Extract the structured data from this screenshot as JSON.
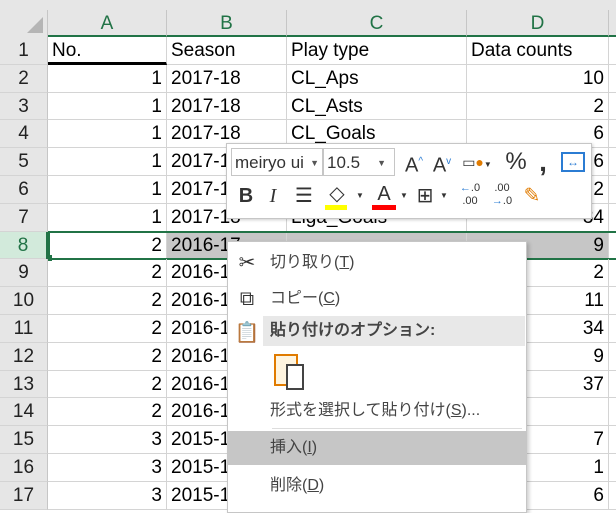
{
  "columns": [
    "A",
    "B",
    "C",
    "D"
  ],
  "rows": [
    {
      "n": "1",
      "a": "No.",
      "b": "Season",
      "c": "Play type",
      "d": "Data counts",
      "header": true
    },
    {
      "n": "2",
      "a": "1",
      "b": "2017-18",
      "c": "CL_Aps",
      "d": "10"
    },
    {
      "n": "3",
      "a": "1",
      "b": "2017-18",
      "c": "CL_Asts",
      "d": "2"
    },
    {
      "n": "4",
      "a": "1",
      "b": "2017-18",
      "c": "CL_Goals",
      "d": "6"
    },
    {
      "n": "5",
      "a": "1",
      "b": "2017-18",
      "c": "",
      "d": "6"
    },
    {
      "n": "6",
      "a": "1",
      "b": "2017-18",
      "c": "",
      "d": "2"
    },
    {
      "n": "7",
      "a": "1",
      "b": "2017-18",
      "c": "Liga_Goals",
      "d": "34"
    },
    {
      "n": "8",
      "a": "2",
      "b": "2016-17",
      "c": "",
      "d": "9",
      "selected": true
    },
    {
      "n": "9",
      "a": "2",
      "b": "2016-17",
      "c": "",
      "d": "2"
    },
    {
      "n": "10",
      "a": "2",
      "b": "2016-17",
      "c": "",
      "d": "11"
    },
    {
      "n": "11",
      "a": "2",
      "b": "2016-17",
      "c": "",
      "d": "34"
    },
    {
      "n": "12",
      "a": "2",
      "b": "2016-17",
      "c": "",
      "d": "9"
    },
    {
      "n": "13",
      "a": "2",
      "b": "2016-17",
      "c": "",
      "d": "37"
    },
    {
      "n": "14",
      "a": "2",
      "b": "2016-17",
      "c": "",
      "d": ""
    },
    {
      "n": "15",
      "a": "3",
      "b": "2015-16",
      "c": "",
      "d": "7"
    },
    {
      "n": "16",
      "a": "3",
      "b": "2015-16",
      "c": "",
      "d": "1"
    },
    {
      "n": "17",
      "a": "3",
      "b": "2015-16",
      "c": "",
      "d": "6"
    }
  ],
  "mini_toolbar": {
    "font": "meiryo ui",
    "size": "10.5",
    "fill_color": "#ffff00",
    "font_color": "#ff0000"
  },
  "context_menu": {
    "cut": {
      "label": "切り取り(",
      "key": "T",
      "end": ")"
    },
    "copy": {
      "label": "コピー(",
      "key": "C",
      "end": ")"
    },
    "paste_header": "貼り付けのオプション:",
    "paste_special": {
      "label": "形式を選択して貼り付け(",
      "key": "S",
      "end": ")..."
    },
    "insert": {
      "label": "挿入(",
      "key": "I",
      "end": ")"
    },
    "delete": {
      "label": "削除(",
      "key": "D",
      "end": ")"
    }
  },
  "accent": "#217346"
}
